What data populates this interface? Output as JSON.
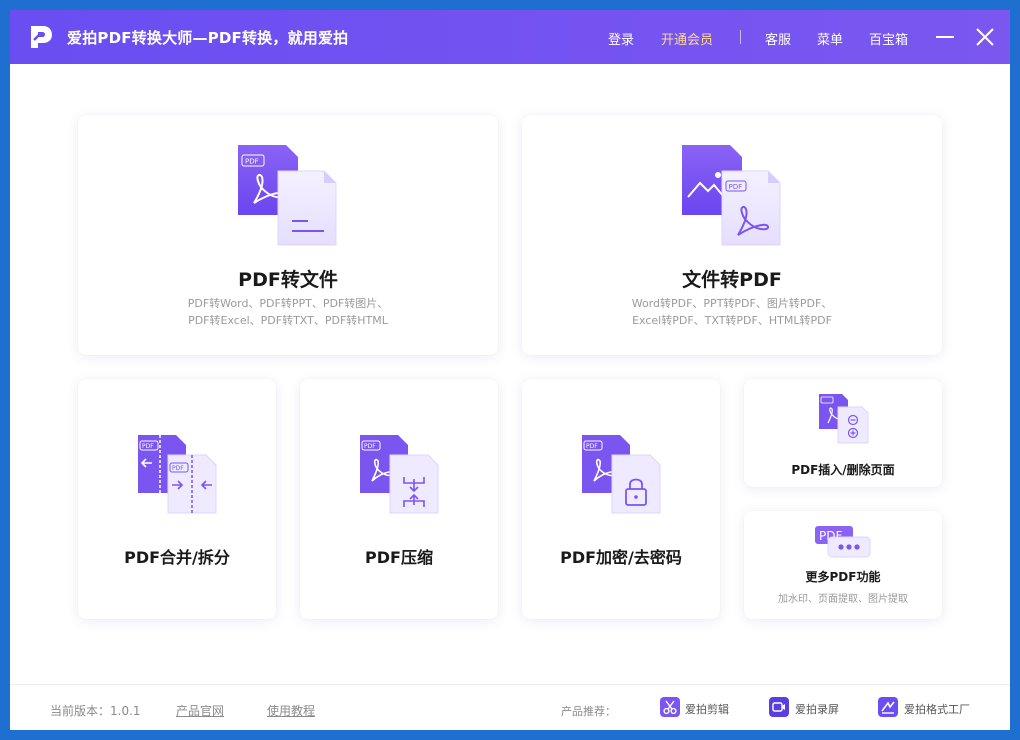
{
  "titlebar": {
    "title": "爱拍PDF转换大师—PDF转换，就用爱拍",
    "login": "登录",
    "vip": "开通会员",
    "service": "客服",
    "menu": "菜单",
    "toolbox": "百宝箱",
    "colors": {
      "bar": "#6a4ef2",
      "vip_text": "#ffd99a"
    }
  },
  "cards": {
    "pdf_to_file": {
      "title": "PDF转文件",
      "desc1": "PDF转Word、PDF转PPT、PDF转图片、",
      "desc2": "PDF转Excel、PDF转TXT、PDF转HTML"
    },
    "file_to_pdf": {
      "title": "文件转PDF",
      "desc1": "Word转PDF、PPT转PDF、图片转PDF、",
      "desc2": "Excel转PDF、TXT转PDF、HTML转PDF"
    },
    "merge_split": {
      "title": "PDF合并/拆分"
    },
    "compress": {
      "title": "PDF压缩"
    },
    "encrypt": {
      "title": "PDF加密/去密码"
    },
    "insert_delete": {
      "title": "PDF插入/删除页面"
    },
    "more": {
      "title": "更多PDF功能",
      "desc": "加水印、页面提取、图片提取"
    }
  },
  "icon_text": {
    "pdf_tag": "PDF"
  },
  "footer": {
    "version": "当前版本：1.0.1",
    "official_site": "产品官网",
    "tutorial": "使用教程",
    "recommend": "产品推荐：",
    "products": [
      {
        "name": "爱拍剪辑",
        "icon": "scissors-icon"
      },
      {
        "name": "爱拍录屏",
        "icon": "record-icon"
      },
      {
        "name": "爱拍格式工厂",
        "icon": "format-factory-icon"
      }
    ]
  }
}
